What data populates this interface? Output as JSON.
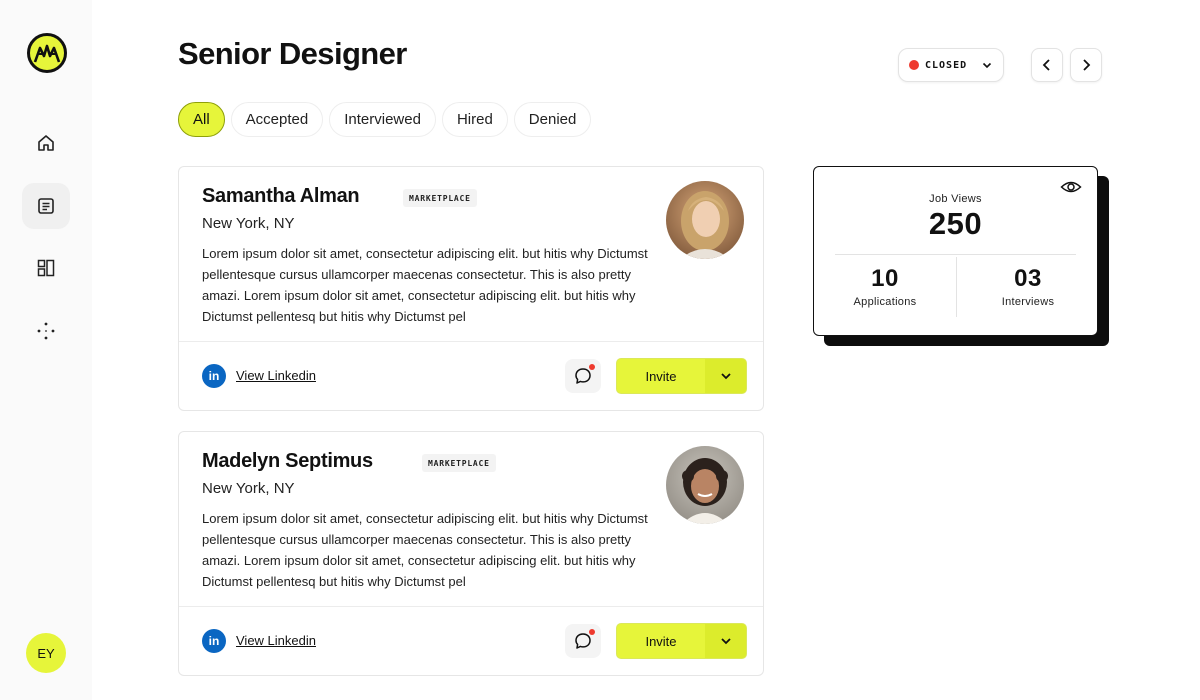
{
  "sidebar": {
    "items": [
      {
        "name": "home",
        "icon": "home-icon"
      },
      {
        "name": "document",
        "icon": "document-icon"
      },
      {
        "name": "layout",
        "icon": "layout-icon"
      },
      {
        "name": "sparkle",
        "icon": "sparkle-icon"
      }
    ],
    "user_initials": "EY"
  },
  "header": {
    "title": "Senior Designer",
    "status": {
      "label": "CLOSED",
      "color": "#ee3a2e"
    }
  },
  "tabs": [
    {
      "label": "All",
      "active": true
    },
    {
      "label": "Accepted",
      "active": false
    },
    {
      "label": "Interviewed",
      "active": false
    },
    {
      "label": "Hired",
      "active": false
    },
    {
      "label": "Denied",
      "active": false
    }
  ],
  "candidates": [
    {
      "name": "Samantha Alman",
      "badge": "MARKETPLACE",
      "location": "New York, NY",
      "description": "Lorem ipsum dolor sit amet, consectetur adipiscing elit.  but hitis why Dictumst pellentesque cursus ullamcorper maecenas consectetur. This is also pretty amazi. Lorem ipsum dolor sit amet, consectetur adipiscing elit. but hitis why Dictumst pellentesq but hitis why Dictumst pel",
      "linkedin_label": "View Linkedin",
      "linkedin_icon": "in",
      "invite_label": "Invite"
    },
    {
      "name": "Madelyn Septimus",
      "badge": "MARKETPLACE",
      "location": "New York, NY",
      "description": "Lorem ipsum dolor sit amet, consectetur adipiscing elit.  but hitis why Dictumst pellentesque cursus ullamcorper maecenas consectetur. This is also pretty amazi. Lorem ipsum dolor sit amet, consectetur adipiscing elit. but hitis why Dictumst pellentesq but hitis why Dictumst pel",
      "linkedin_label": "View Linkedin",
      "linkedin_icon": "in",
      "invite_label": "Invite"
    }
  ],
  "stats": {
    "job_views_label": "Job Views",
    "job_views": "250",
    "applications_label": "Applications",
    "applications": "10",
    "interviews_label": "Interviews",
    "interviews": "03"
  },
  "colors": {
    "accent": "#e6f53a",
    "linkedin": "#0a66c2",
    "notification": "#ee3a2e"
  }
}
